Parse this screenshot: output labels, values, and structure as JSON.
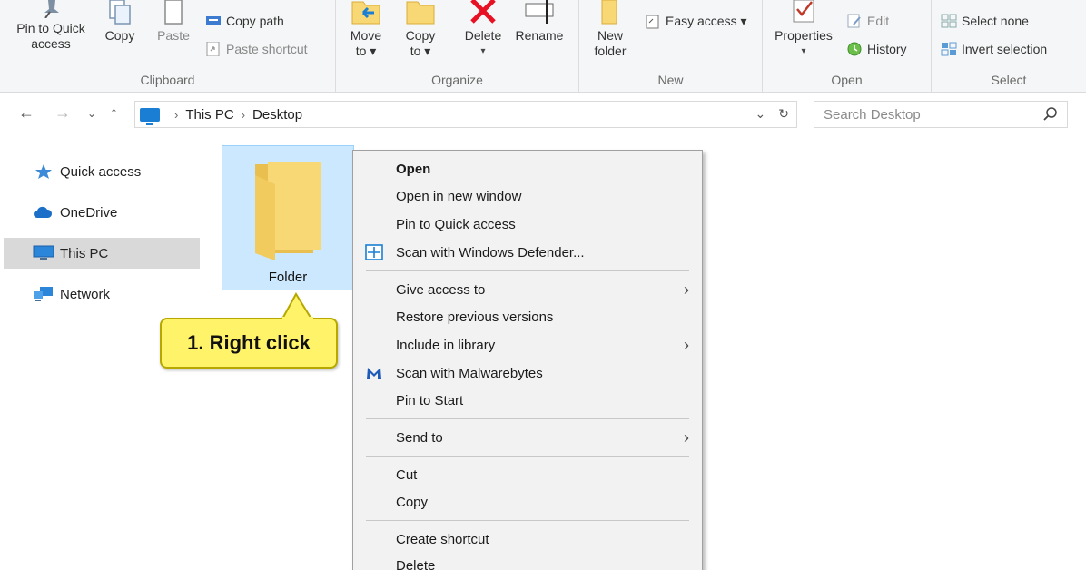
{
  "ribbon": {
    "clipboard": {
      "label": "Clipboard",
      "pin_to_quick_access": "Pin to Quick access",
      "copy": "Copy",
      "paste": "Paste",
      "copy_path": "Copy path",
      "paste_shortcut": "Paste shortcut"
    },
    "organize": {
      "label": "Organize",
      "move_to": "Move to ▾",
      "copy_to": "Copy to ▾",
      "delete": "Delete",
      "rename": "Rename"
    },
    "new": {
      "label": "New",
      "new_folder": "New folder",
      "easy_access": "Easy access ▾"
    },
    "open": {
      "label": "Open",
      "properties": "Properties",
      "edit": "Edit",
      "history": "History"
    },
    "select": {
      "label": "Select",
      "select_none": "Select none",
      "invert_selection": "Invert selection"
    }
  },
  "address": {
    "crumbs": [
      "This PC",
      "Desktop"
    ],
    "search_placeholder": "Search Desktop"
  },
  "nav_pane": {
    "items": [
      {
        "label": "Quick access",
        "icon": "star-icon"
      },
      {
        "label": "OneDrive",
        "icon": "cloud-icon"
      },
      {
        "label": "This PC",
        "icon": "computer-icon",
        "selected": true
      },
      {
        "label": "Network",
        "icon": "network-icon"
      }
    ]
  },
  "content": {
    "folder_name": "Folder"
  },
  "callout": {
    "text": "1. Right click"
  },
  "context_menu": {
    "open": "Open",
    "open_new_window": "Open in new window",
    "pin_quick_access": "Pin to Quick access",
    "scan_defender": "Scan with Windows Defender...",
    "give_access": "Give access to",
    "restore_versions": "Restore previous versions",
    "include_library": "Include in library",
    "scan_malwarebytes": "Scan with Malwarebytes",
    "pin_start": "Pin to Start",
    "send_to": "Send to",
    "cut": "Cut",
    "copy": "Copy",
    "create_shortcut": "Create shortcut",
    "delete": "Delete"
  },
  "colors": {
    "accent": "#1a7fd4",
    "folder_yellow": "#f8d775",
    "selection": "#cce8ff",
    "callout": "#fff36a",
    "delete_red": "#e81123"
  }
}
